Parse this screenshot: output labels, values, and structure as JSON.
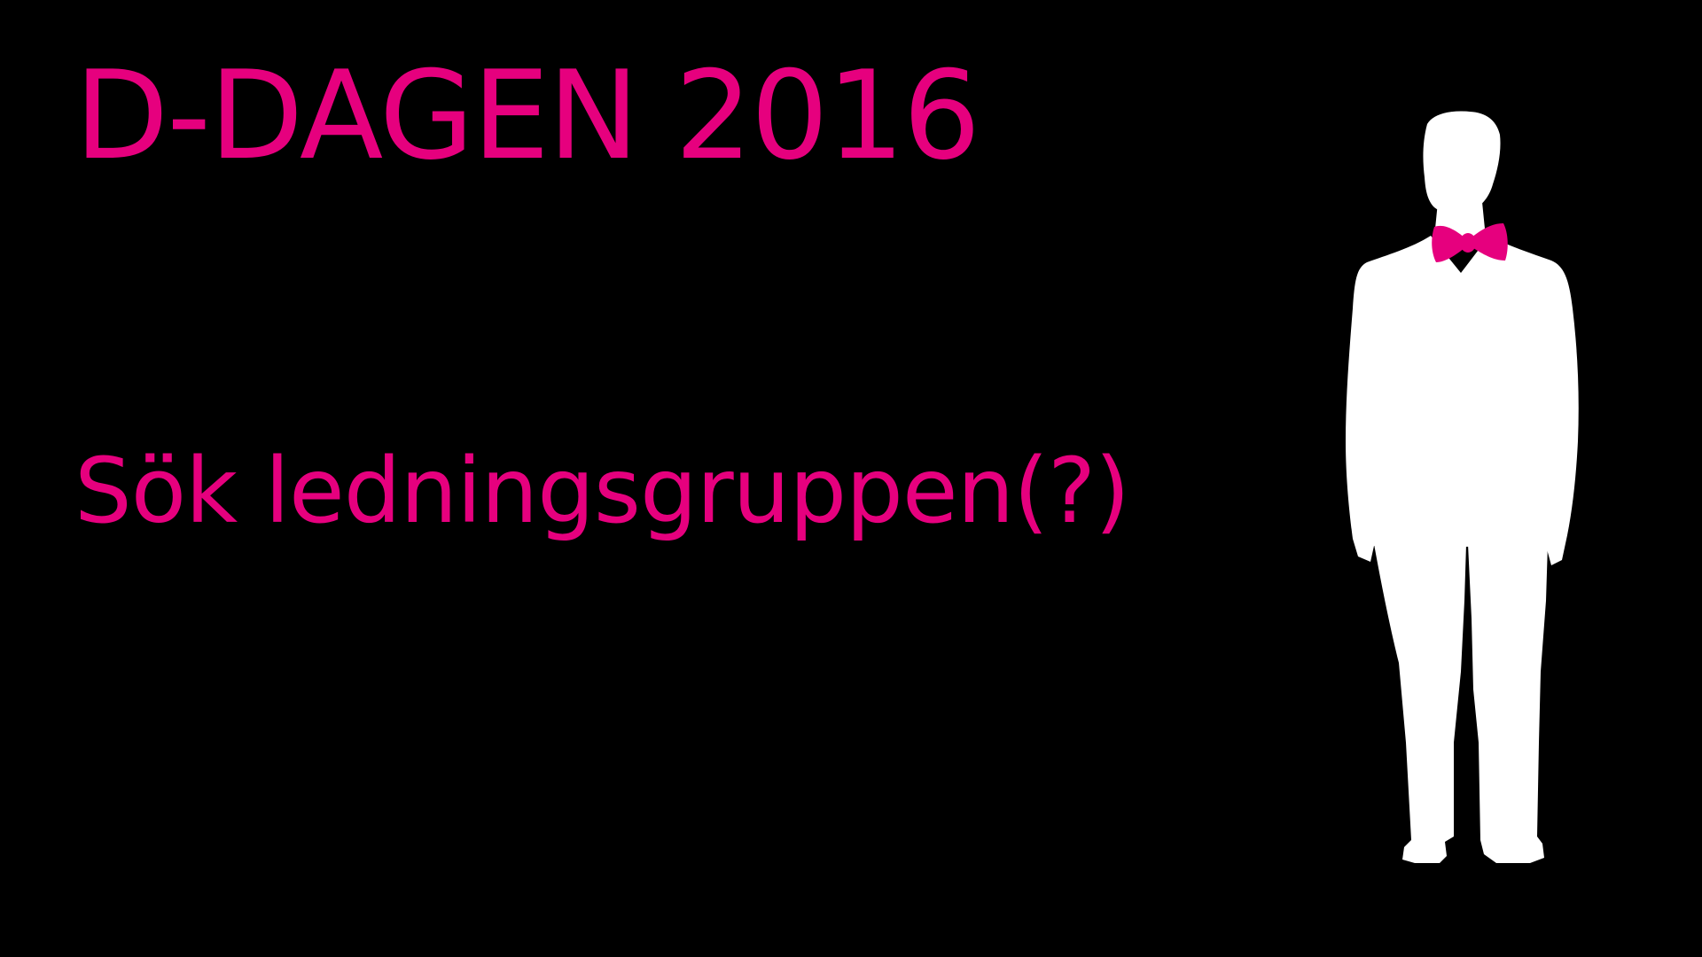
{
  "slide": {
    "title": "D-DAGEN 2016",
    "subtitle": "Sök ledningsgruppen(?)"
  },
  "illustration": {
    "icon": "man-in-suit-with-bow-tie-silhouette-icon",
    "bow_tie_icon": "bow-tie-icon"
  },
  "colors": {
    "background": "#000000",
    "accent": "#e6007e",
    "silhouette": "#ffffff"
  }
}
